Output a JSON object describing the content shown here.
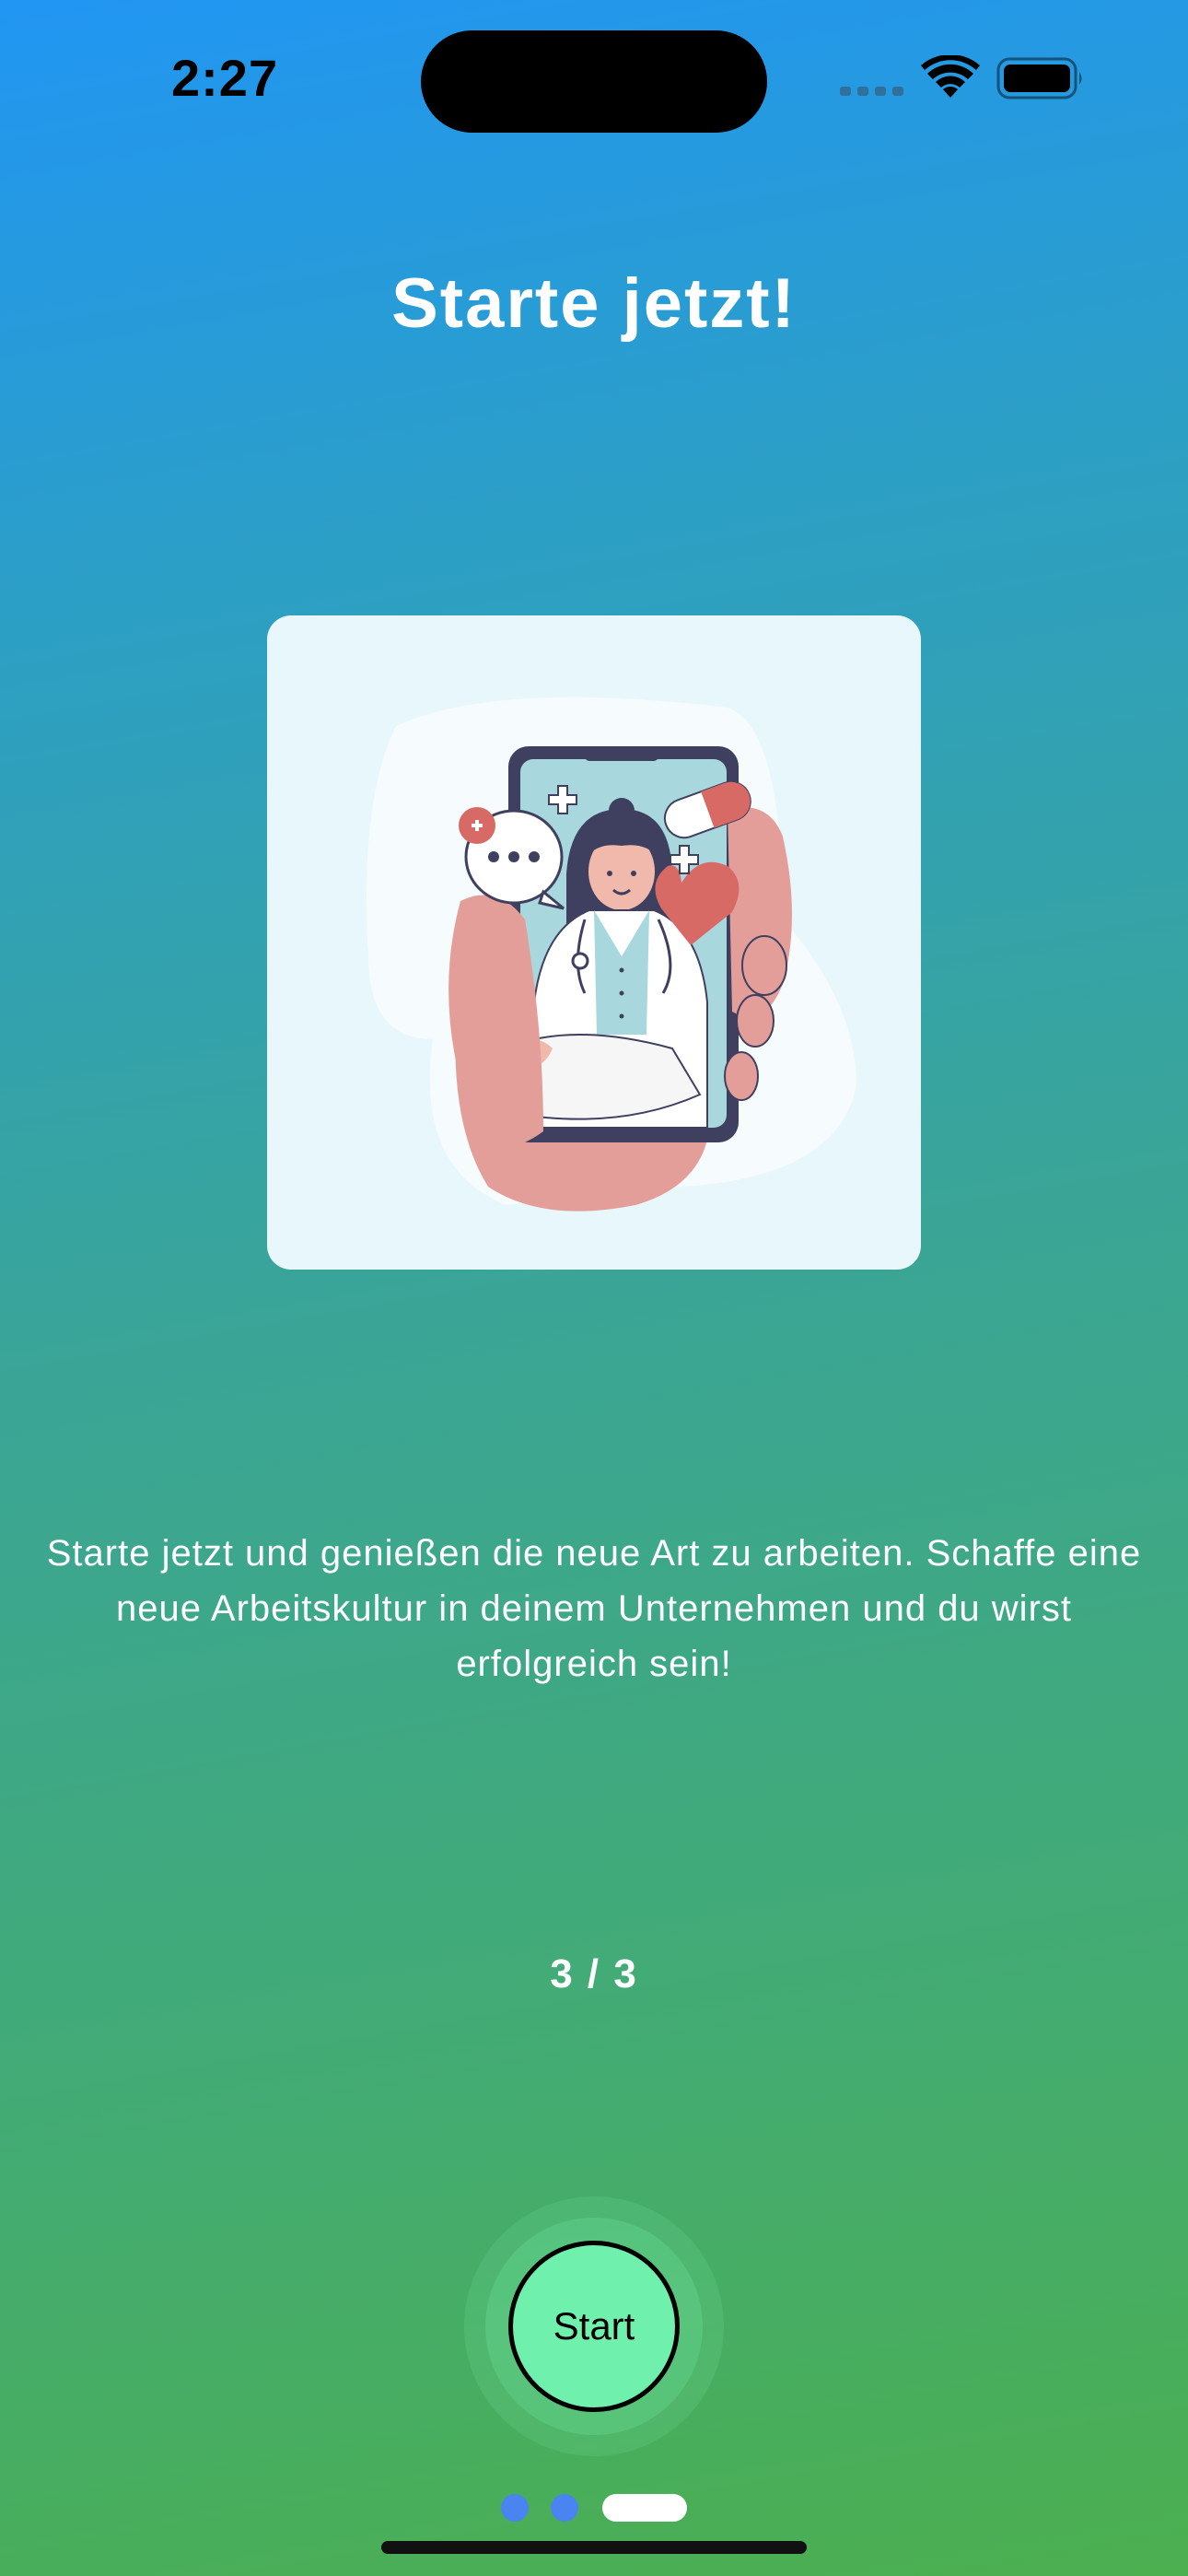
{
  "status_bar": {
    "time": "2:27",
    "icons": [
      "cellular-signal-icon",
      "wifi-icon",
      "battery-icon"
    ]
  },
  "onboarding": {
    "title": "Starte jetzt!",
    "illustration": "doctor-on-phone-illustration",
    "description": "Starte jetzt und genießen die neue Art zu arbeiten. Schaffe eine neue Arbeitskultur in deinem Unternehmen und du wirst erfolgreich sein!",
    "page_counter": "3 / 3",
    "start_label": "Start",
    "pagination": {
      "total": 3,
      "current": 3
    }
  },
  "colors": {
    "gradient_top": "#2196f3",
    "gradient_bottom": "#4caf50",
    "button_fill": "#6ff0ad",
    "dot_inactive": "#4a84f0",
    "dot_active": "#ffffff",
    "card_background": "#e8f7fb"
  }
}
